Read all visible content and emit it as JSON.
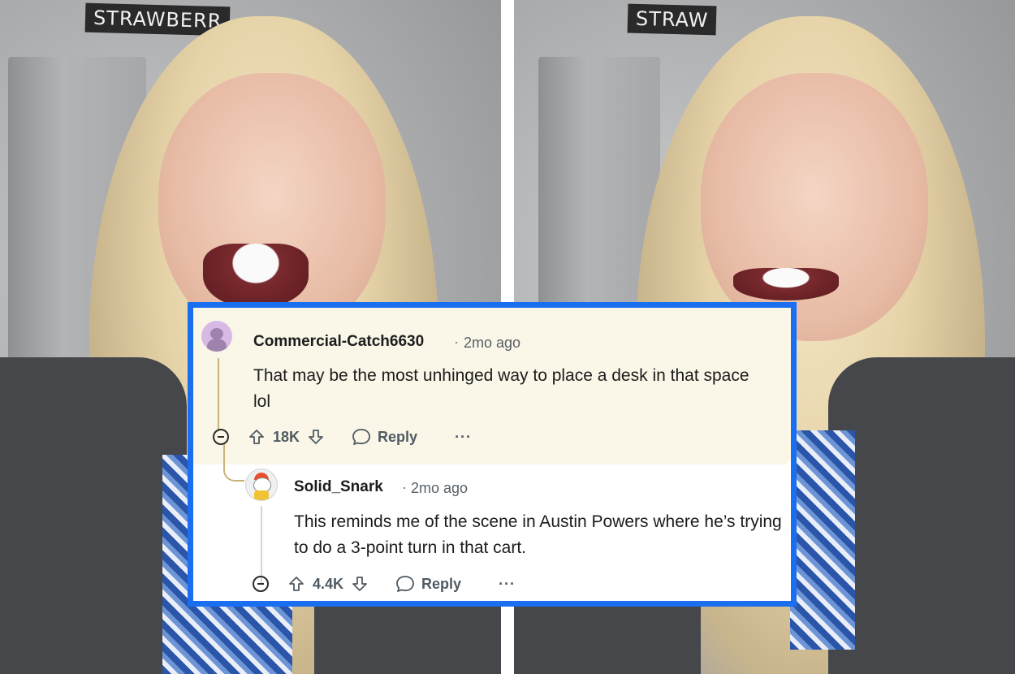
{
  "background": {
    "left_sign": "STRAWBERR",
    "right_sign": "STRAW"
  },
  "comments": [
    {
      "username": "Commercial-Catch6630",
      "separator": "·",
      "time": "2mo ago",
      "body": "That may be the most unhinged way to place a desk in that space lol",
      "votes": "18K",
      "reply_label": "Reply",
      "more": "···"
    },
    {
      "username": "Solid_Snark",
      "separator": "·",
      "time": "2mo ago",
      "body": "This reminds me of the scene in Austin Powers where he’s trying to do a 3-point turn in that cart.",
      "votes": "4.4K",
      "reply_label": "Reply",
      "more": "···"
    }
  ],
  "colors": {
    "card_border": "#1a6ef0",
    "highlight_bg": "#faf7e8"
  }
}
